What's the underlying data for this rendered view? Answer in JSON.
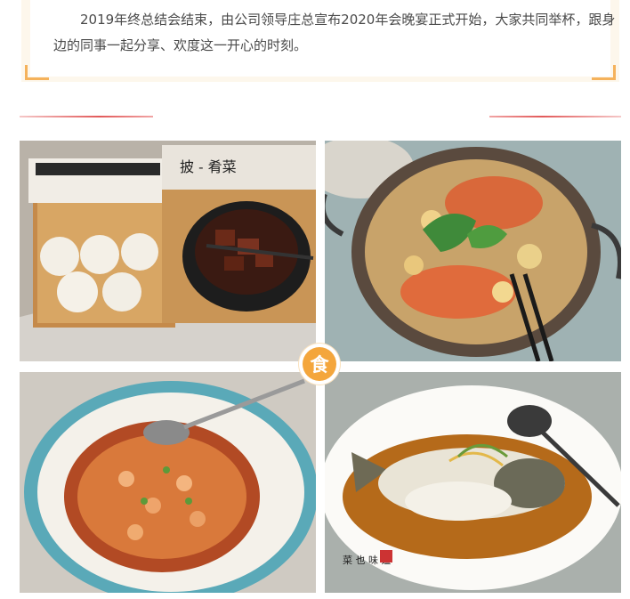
{
  "intro": {
    "text": "2019年终总结会结束，由公司领导庄总宣布2020年会晚宴正式开始，大家共同举杯，跟身边的同事一起分享、欢度这一开心的时刻。"
  },
  "badge": {
    "label": "食"
  },
  "colors": {
    "accent_orange": "#f4a63c",
    "divider_red": "#e25a5a",
    "intro_bg": "#fdf7ec"
  },
  "photos": [
    {
      "subject": "steamed buns and braised pork in clay pot"
    },
    {
      "subject": "crab stir-fry in metal pot"
    },
    {
      "subject": "spicy shrimp on blue-rimmed plate"
    },
    {
      "subject": "steamed fish on white plate"
    }
  ]
}
